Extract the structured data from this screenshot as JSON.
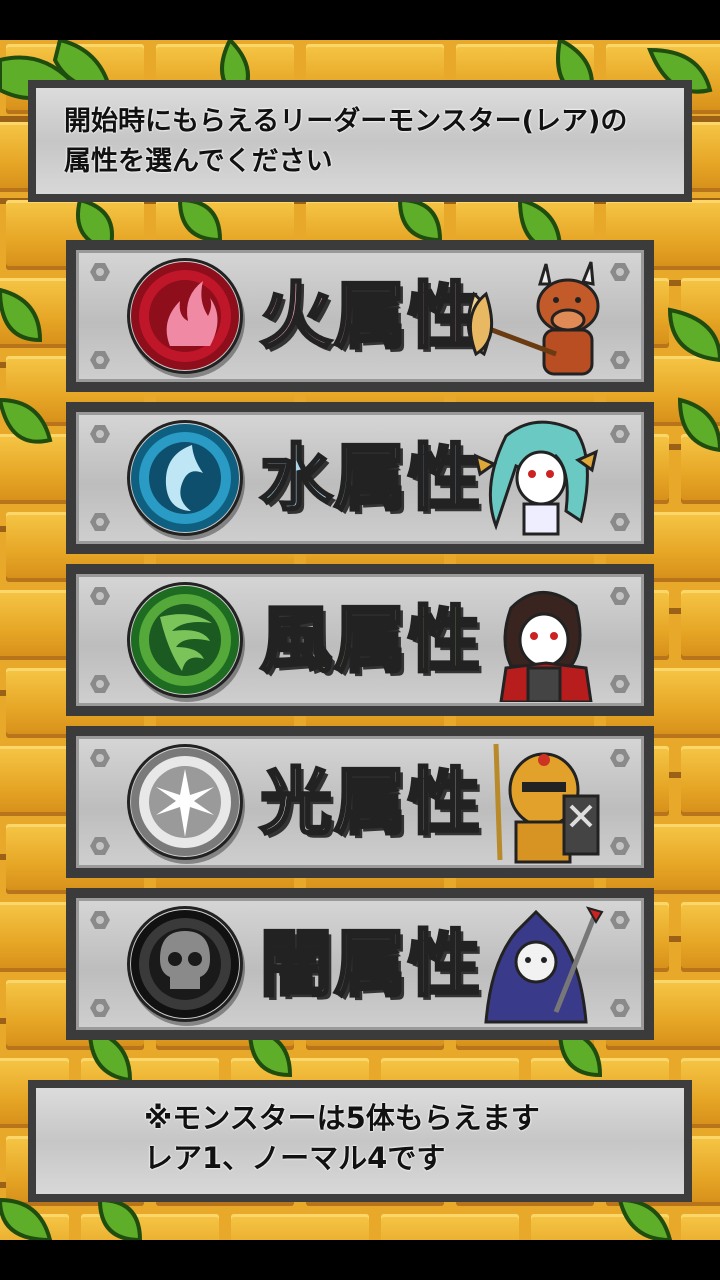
{
  "header": {
    "line1": "開始時にもらえるリーダーモンスター(レア)の",
    "line2": "属性を選んでください"
  },
  "attributes": [
    {
      "label": "火属性",
      "color": "#f5a3c0",
      "orb": "#c0162a",
      "icon": "fire-icon",
      "monster": "minotaur-monster"
    },
    {
      "label": "水属性",
      "color": "#a9d6ef",
      "orb": "#1d86ad",
      "icon": "water-icon",
      "monster": "mermaid-monster"
    },
    {
      "label": "風属性",
      "color": "#9fd06a",
      "orb": "#2f8a32",
      "icon": "wind-icon",
      "monster": "vampire-monster"
    },
    {
      "label": "光属性",
      "color": "#ffffff",
      "orb": "#a9a9a9",
      "icon": "light-icon",
      "monster": "knight-monster"
    },
    {
      "label": "闇属性",
      "color": "#9a9a9a",
      "orb": "#2a2a2a",
      "icon": "dark-skull-icon",
      "monster": "reaper-monster"
    }
  ],
  "footer": {
    "line1": "※モンスターは5体もらえます",
    "line2": "レア1、ノーマル4です"
  }
}
